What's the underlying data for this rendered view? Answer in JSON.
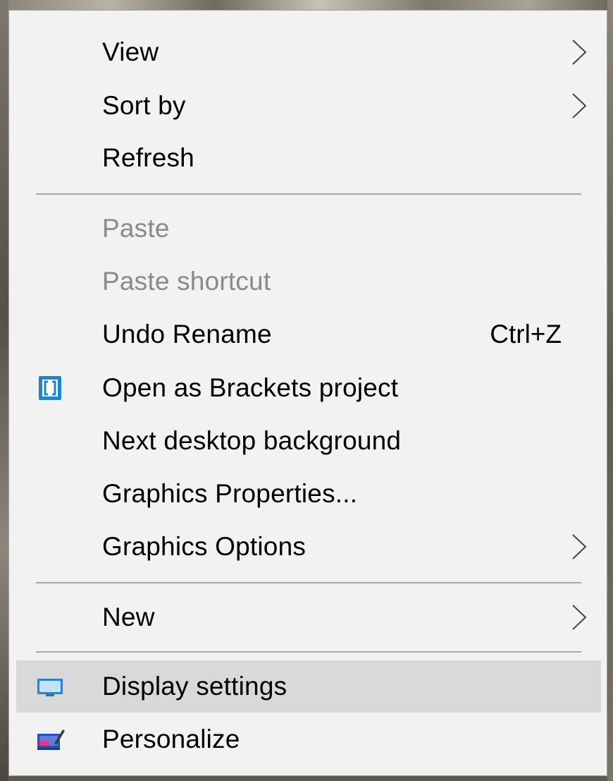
{
  "menu": {
    "items": [
      {
        "label": "View",
        "submenu": true,
        "disabled": false
      },
      {
        "label": "Sort by",
        "submenu": true,
        "disabled": false
      },
      {
        "label": "Refresh",
        "submenu": false,
        "disabled": false
      },
      {
        "label": "Paste",
        "submenu": false,
        "disabled": true
      },
      {
        "label": "Paste shortcut",
        "submenu": false,
        "disabled": true
      },
      {
        "label": "Undo Rename",
        "shortcut": "Ctrl+Z",
        "submenu": false,
        "disabled": false
      },
      {
        "label": "Open as Brackets project",
        "icon": "brackets-icon",
        "submenu": false,
        "disabled": false
      },
      {
        "label": "Next desktop background",
        "submenu": false,
        "disabled": false
      },
      {
        "label": "Graphics Properties...",
        "submenu": false,
        "disabled": false
      },
      {
        "label": "Graphics Options",
        "submenu": true,
        "disabled": false
      },
      {
        "label": "New",
        "submenu": true,
        "disabled": false
      },
      {
        "label": "Display settings",
        "icon": "display-icon",
        "submenu": false,
        "disabled": false,
        "highlighted": true
      },
      {
        "label": "Personalize",
        "icon": "personalize-icon",
        "submenu": false,
        "disabled": false
      }
    ]
  },
  "colors": {
    "menu_background": "#f2f2f2",
    "highlight": "#d9d9d9",
    "disabled_text": "#8a8a8a",
    "brackets_icon_blue": "#1b86c9",
    "display_icon_blue": "#3a8fd8"
  }
}
